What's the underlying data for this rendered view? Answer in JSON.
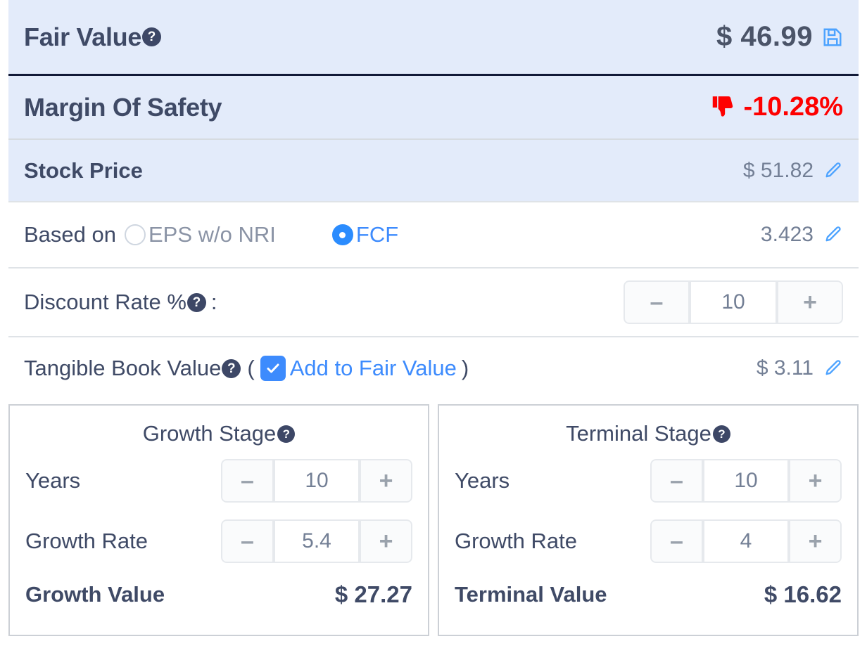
{
  "colors": {
    "band": "#e3ebfa",
    "dark_text": "#3f4a66",
    "muted_text": "#737f95",
    "accent_blue": "#3d8bfd",
    "radio_blue": "#2b8cfe",
    "negative_red": "#fe0000",
    "separator_dark": "#121a38",
    "separator_light": "#d6dbe0",
    "panel_border": "#ccd0d6"
  },
  "fair_value": {
    "label": "Fair Value",
    "help": "?",
    "currency": "$",
    "value": "46.99",
    "value_display": "$ 46.99",
    "save_icon": "save-icon"
  },
  "margin_of_safety": {
    "label": "Margin Of Safety",
    "value": "-10.28%",
    "indicator_icon": "thumbs-down-icon",
    "is_negative": true
  },
  "stock_price": {
    "label": "Stock Price",
    "value_display": "$ 51.82",
    "edit_icon": "pencil-icon"
  },
  "based_on": {
    "label": "Based on",
    "options": [
      {
        "label": "EPS w/o NRI",
        "selected": false
      },
      {
        "label": "FCF",
        "selected": true
      }
    ],
    "value": "3.423",
    "edit_icon": "pencil-icon"
  },
  "discount_rate": {
    "label": "Discount Rate %",
    "help": "?",
    "colon": ":",
    "stepper": {
      "minus": "–",
      "value": "10",
      "plus": "+"
    }
  },
  "tangible_book_value": {
    "label": "Tangible Book Value",
    "help": "?",
    "paren_open": "(",
    "checkbox_checked": true,
    "checkbox_label": "Add to Fair Value",
    "paren_close": ")",
    "value_display": "$ 3.11",
    "edit_icon": "pencil-icon"
  },
  "growth_stage": {
    "title": "Growth Stage",
    "help": "?",
    "years": {
      "label": "Years",
      "minus": "–",
      "value": "10",
      "plus": "+"
    },
    "growth_rate": {
      "label": "Growth Rate",
      "minus": "–",
      "value": "5.4",
      "plus": "+"
    },
    "total_label": "Growth Value",
    "total_value": "$ 27.27"
  },
  "terminal_stage": {
    "title": "Terminal Stage",
    "help": "?",
    "years": {
      "label": "Years",
      "minus": "–",
      "value": "10",
      "plus": "+"
    },
    "growth_rate": {
      "label": "Growth Rate",
      "minus": "–",
      "value": "4",
      "plus": "+"
    },
    "total_label": "Terminal Value",
    "total_value": "$ 16.62"
  }
}
